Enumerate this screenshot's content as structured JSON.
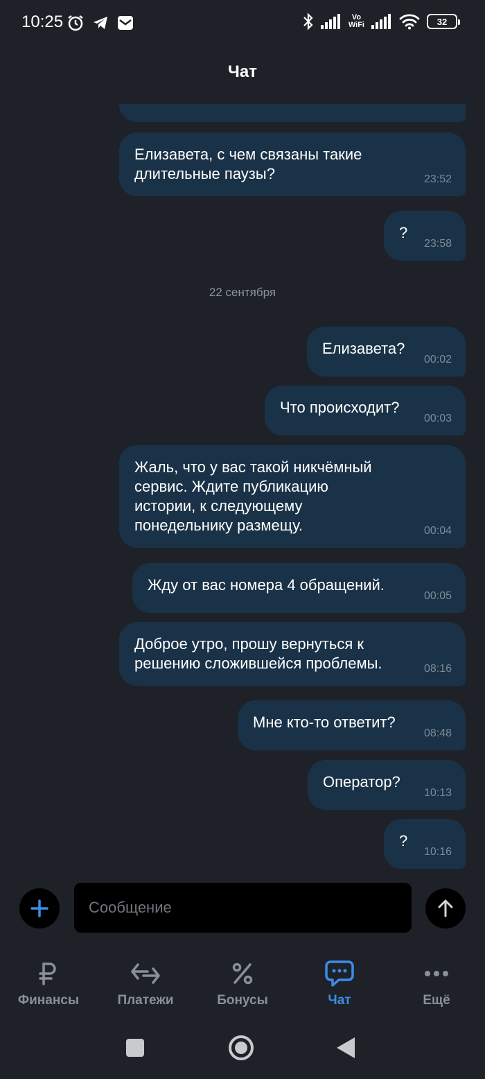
{
  "status_bar": {
    "time": "10:25",
    "vowifi_top": "Vo",
    "vowifi_bottom": "WiFi",
    "battery": "32"
  },
  "header": {
    "title": "Чат"
  },
  "chat": {
    "messages": [
      {
        "text": "Елизавета, с чем связаны такие\nдлительные паузы?",
        "time": "23:52"
      },
      {
        "text": "?",
        "time": "23:58"
      },
      {
        "text": "Елизавета?",
        "time": "00:02"
      },
      {
        "text": "Что происходит?",
        "time": "00:03"
      },
      {
        "text": "Жаль, что у вас такой никчёмный\nсервис. Ждите публикацию\nистории, к следующему\nпонедельнику размещу.",
        "time": "00:04"
      },
      {
        "text": "Жду от вас номера 4 обращений.",
        "time": "00:05"
      },
      {
        "text": "Доброе утро, прошу вернуться к\nрешению сложившейся проблемы.",
        "time": "08:16"
      },
      {
        "text": "Мне кто-то ответит?",
        "time": "08:48"
      },
      {
        "text": "Оператор?",
        "time": "10:13"
      },
      {
        "text": "?",
        "time": "10:16"
      }
    ],
    "date_separator": "22 сентября"
  },
  "composer": {
    "placeholder": "Сообщение"
  },
  "bottom_nav": {
    "items": [
      {
        "label": "Финансы",
        "icon": "ruble-icon"
      },
      {
        "label": "Платежи",
        "icon": "transfer-arrows-icon"
      },
      {
        "label": "Бонусы",
        "icon": "percent-icon"
      },
      {
        "label": "Чат",
        "icon": "chat-bubble-icon",
        "active": true
      },
      {
        "label": "Ещё",
        "icon": "more-dots-icon"
      }
    ]
  },
  "colors": {
    "background": "#1e2228",
    "bubble": "#1a3247",
    "accent": "#3c8ce7",
    "inactive": "#8a9099"
  }
}
